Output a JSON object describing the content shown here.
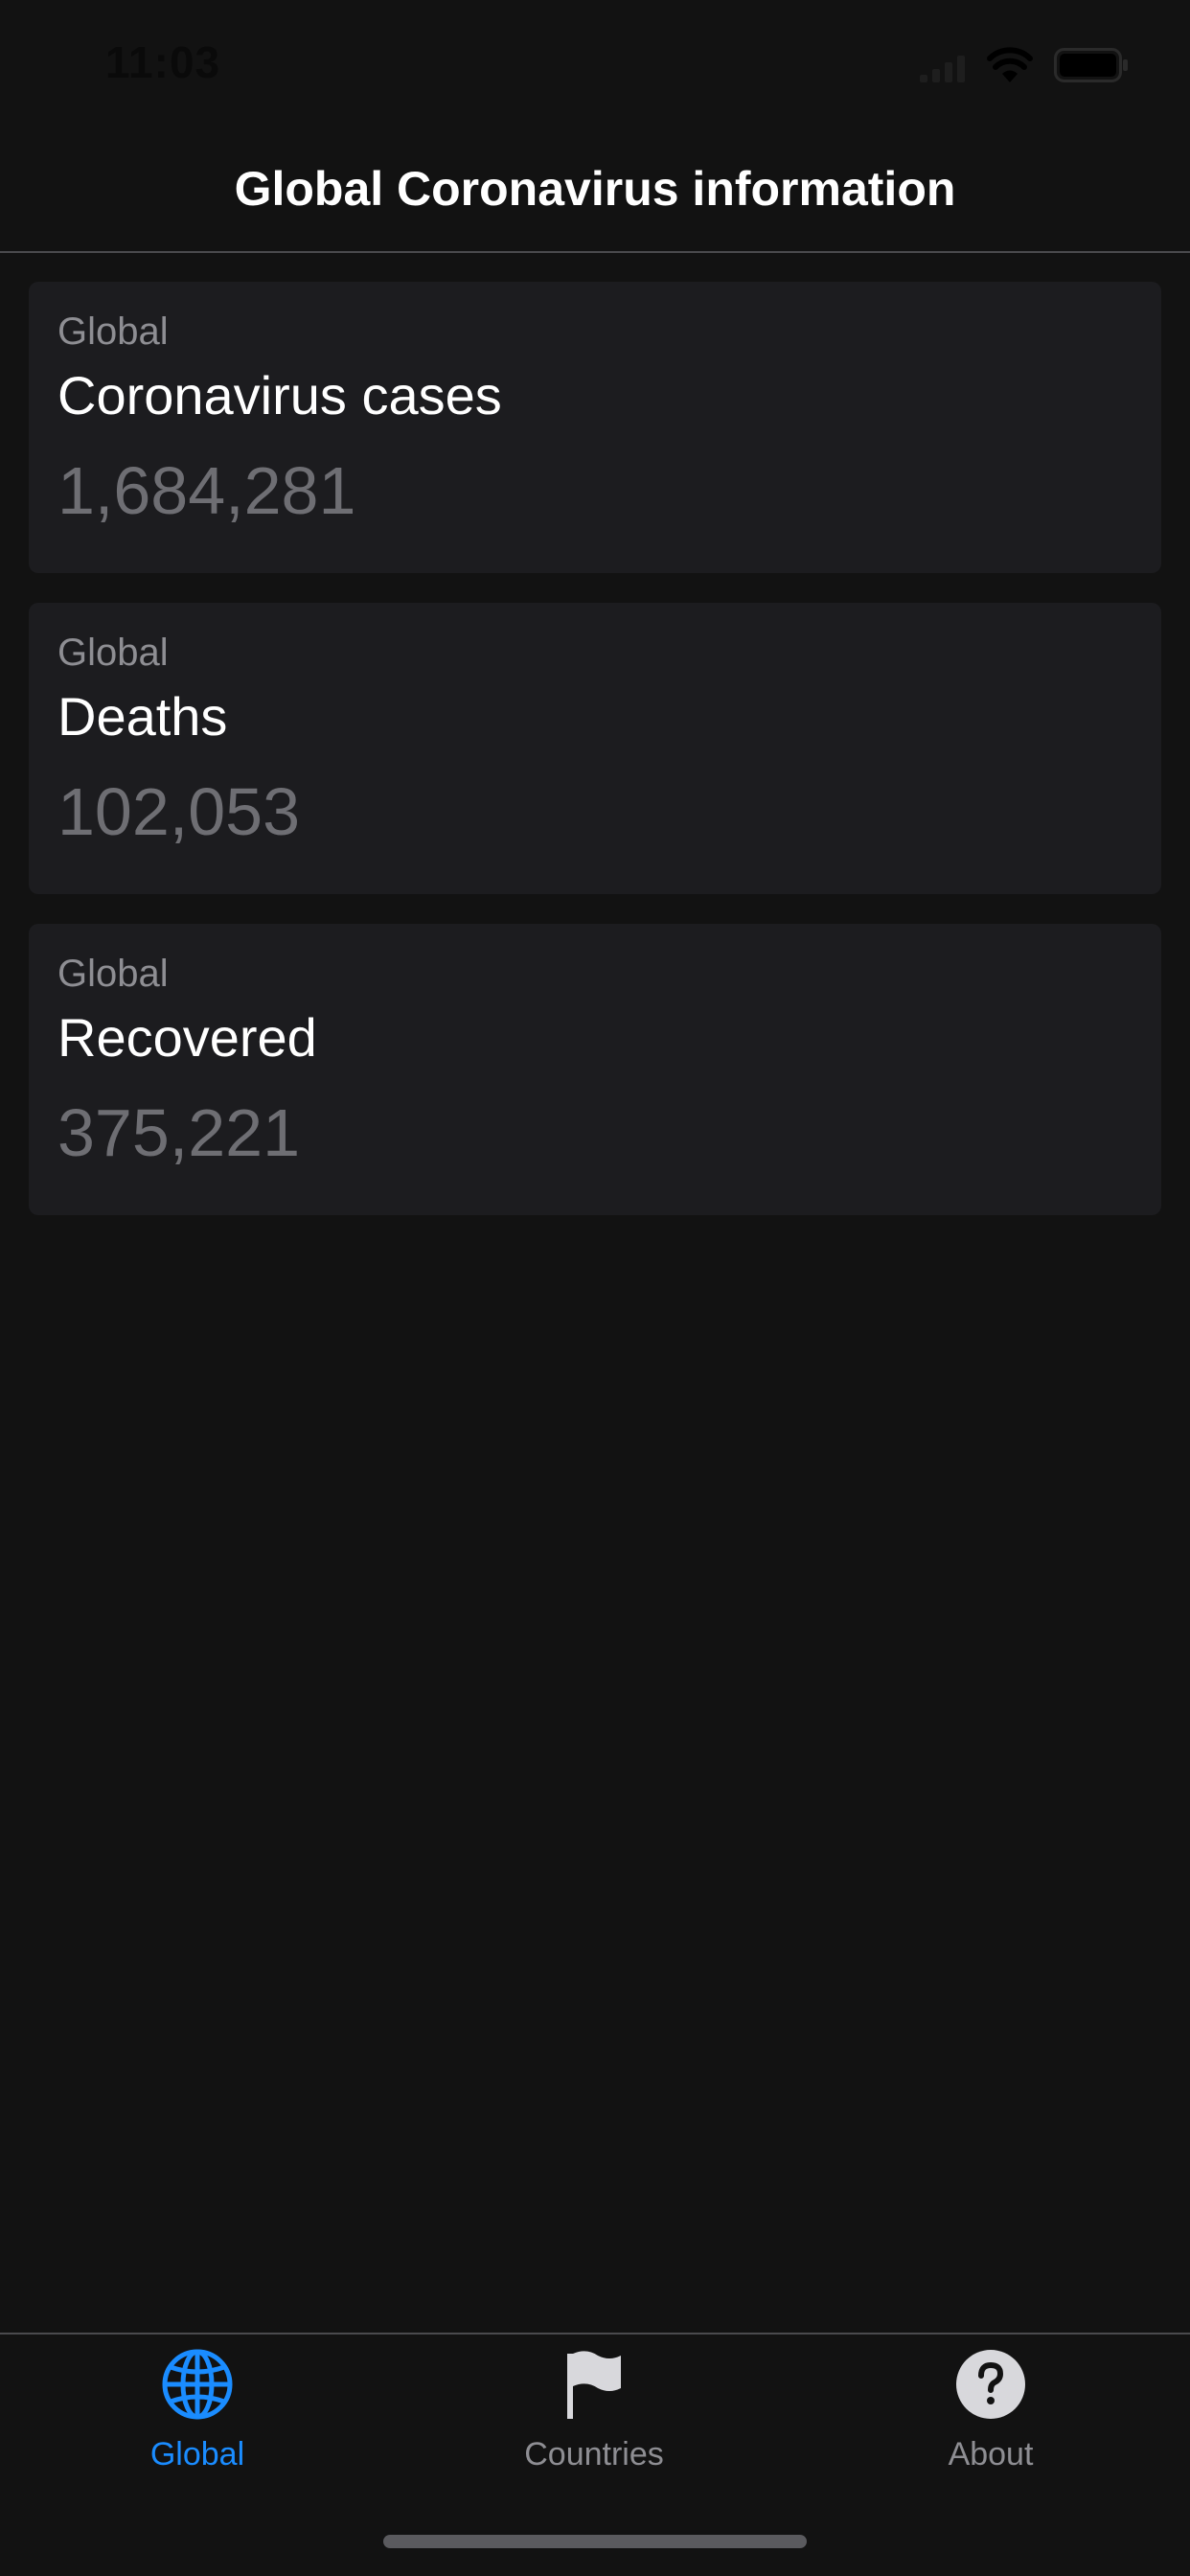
{
  "status_bar": {
    "time": "11:03",
    "icons": [
      "signal-icon",
      "wifi-icon",
      "battery-icon"
    ]
  },
  "nav": {
    "title": "Global Coronavirus information"
  },
  "cards": [
    {
      "kicker": "Global",
      "title": "Coronavirus cases",
      "value": "1,684,281"
    },
    {
      "kicker": "Global",
      "title": "Deaths",
      "value": "102,053"
    },
    {
      "kicker": "Global",
      "title": "Recovered",
      "value": "375,221"
    }
  ],
  "tabs": [
    {
      "label": "Global",
      "icon": "globe-icon",
      "selected": true
    },
    {
      "label": "Countries",
      "icon": "flag-icon",
      "selected": false
    },
    {
      "label": "About",
      "icon": "question-circle-icon",
      "selected": false
    }
  ],
  "colors": {
    "background": "#121212",
    "card": "#1c1c1f",
    "accent": "#1a8cff",
    "secondary_text": "#8e8e93",
    "value_text": "#6e6e73"
  }
}
